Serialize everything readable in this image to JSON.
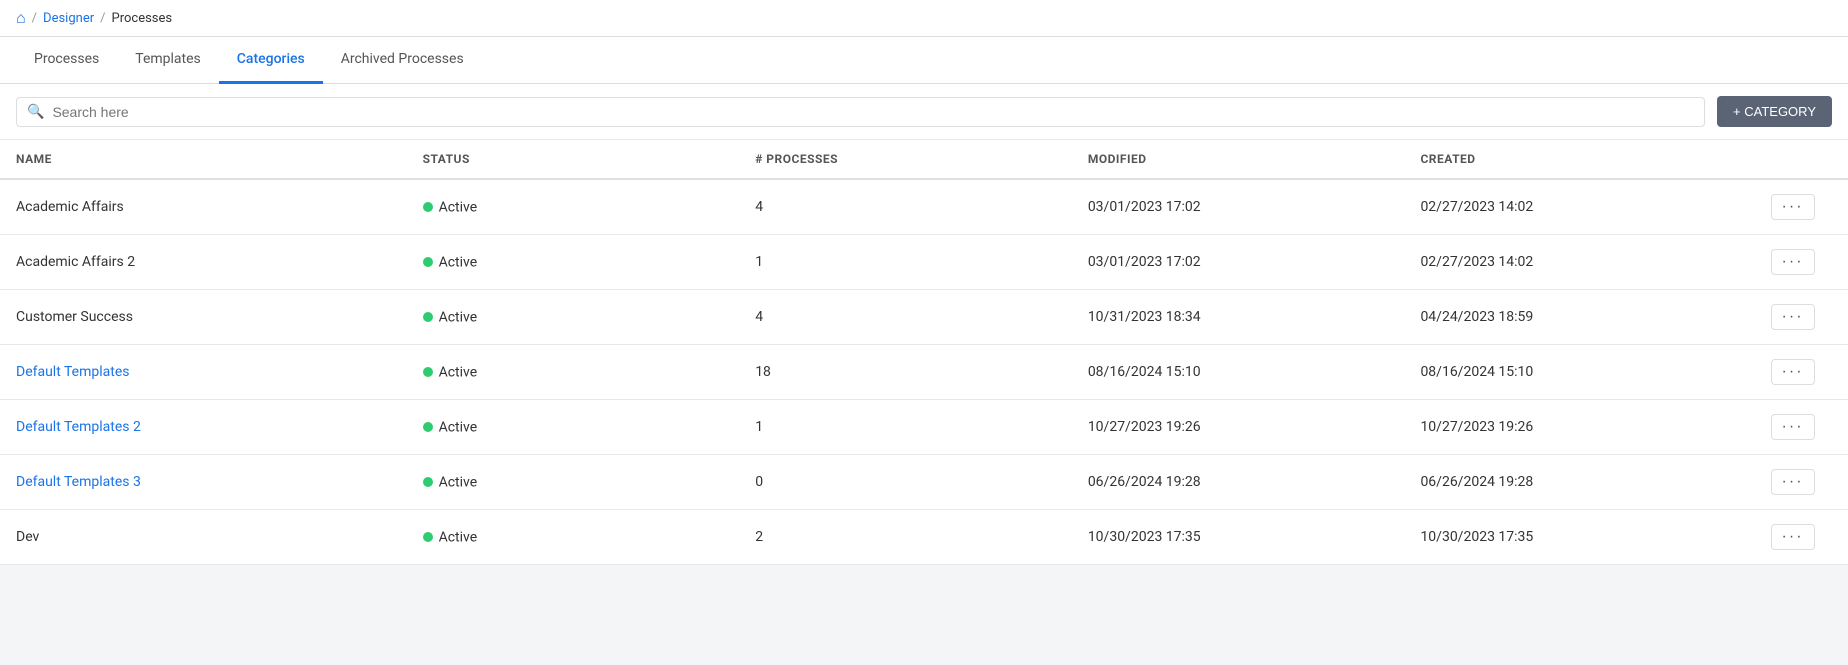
{
  "breadcrumb": {
    "home_icon": "🏠",
    "separator": "/",
    "designer_label": "Designer",
    "current_label": "Processes"
  },
  "tabs": [
    {
      "id": "processes",
      "label": "Processes",
      "active": false
    },
    {
      "id": "templates",
      "label": "Templates",
      "active": false
    },
    {
      "id": "categories",
      "label": "Categories",
      "active": true
    },
    {
      "id": "archived",
      "label": "Archived Processes",
      "active": false
    }
  ],
  "toolbar": {
    "search_placeholder": "Search here",
    "add_button_label": "+ CATEGORY"
  },
  "table": {
    "columns": [
      {
        "id": "name",
        "label": "NAME"
      },
      {
        "id": "status",
        "label": "STATUS"
      },
      {
        "id": "processes",
        "label": "# PROCESSES"
      },
      {
        "id": "modified",
        "label": "MODIFIED"
      },
      {
        "id": "created",
        "label": "CREATED"
      },
      {
        "id": "actions",
        "label": ""
      }
    ],
    "rows": [
      {
        "name": "Academic Affairs",
        "status": "Active",
        "processes": "4",
        "modified": "03/01/2023 17:02",
        "created": "02/27/2023 14:02",
        "is_link": false
      },
      {
        "name": "Academic Affairs 2",
        "status": "Active",
        "processes": "1",
        "modified": "03/01/2023 17:02",
        "created": "02/27/2023 14:02",
        "is_link": false
      },
      {
        "name": "Customer Success",
        "status": "Active",
        "processes": "4",
        "modified": "10/31/2023 18:34",
        "created": "04/24/2023 18:59",
        "is_link": false
      },
      {
        "name": "Default Templates",
        "status": "Active",
        "processes": "18",
        "modified": "08/16/2024 15:10",
        "created": "08/16/2024 15:10",
        "is_link": true
      },
      {
        "name": "Default Templates 2",
        "status": "Active",
        "processes": "1",
        "modified": "10/27/2023 19:26",
        "created": "10/27/2023 19:26",
        "is_link": true
      },
      {
        "name": "Default Templates 3",
        "status": "Active",
        "processes": "0",
        "modified": "06/26/2024 19:28",
        "created": "06/26/2024 19:28",
        "is_link": true
      },
      {
        "name": "Dev",
        "status": "Active",
        "processes": "2",
        "modified": "10/30/2023 17:35",
        "created": "10/30/2023 17:35",
        "is_link": false
      }
    ]
  },
  "icons": {
    "home": "⌂",
    "search": "🔍",
    "ellipsis": "···"
  }
}
